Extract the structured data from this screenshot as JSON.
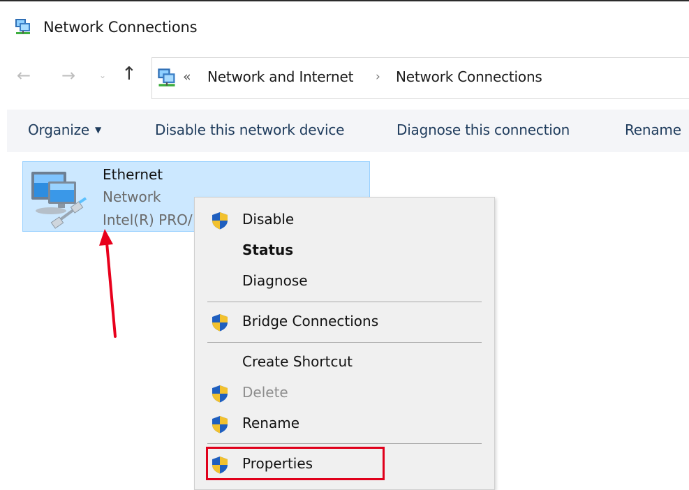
{
  "window": {
    "title": "Network Connections",
    "icon": "network-connections-icon"
  },
  "nav": {
    "back": "←",
    "forward": "→",
    "recent": "⌄",
    "up": "↑",
    "breadcrumb_overflow": "«",
    "breadcrumb": [
      "Network and Internet",
      "Network Connections"
    ],
    "separator": "›"
  },
  "toolbar": {
    "organize": "Organize",
    "disable": "Disable this network device",
    "diagnose": "Diagnose this connection",
    "rename": "Rename"
  },
  "connection": {
    "name": "Ethernet",
    "network": "Network",
    "adapter": "Intel(R) PRO/"
  },
  "context_menu": {
    "items": [
      {
        "label": "Disable",
        "shield": true,
        "bold": false,
        "disabled": false
      },
      {
        "label": "Status",
        "shield": false,
        "bold": true,
        "disabled": false
      },
      {
        "label": "Diagnose",
        "shield": false,
        "bold": false,
        "disabled": false
      },
      {
        "label": "Bridge Connections",
        "shield": true,
        "bold": false,
        "disabled": false
      },
      {
        "label": "Create Shortcut",
        "shield": false,
        "bold": false,
        "disabled": false
      },
      {
        "label": "Delete",
        "shield": true,
        "bold": false,
        "disabled": true
      },
      {
        "label": "Rename",
        "shield": true,
        "bold": false,
        "disabled": false
      },
      {
        "label": "Properties",
        "shield": true,
        "bold": false,
        "disabled": false
      }
    ]
  },
  "colors": {
    "selection": "#cce8ff",
    "highlight_box": "#e0001b",
    "arrow": "#e8001c",
    "toolbar_text": "#1e3b5c"
  }
}
